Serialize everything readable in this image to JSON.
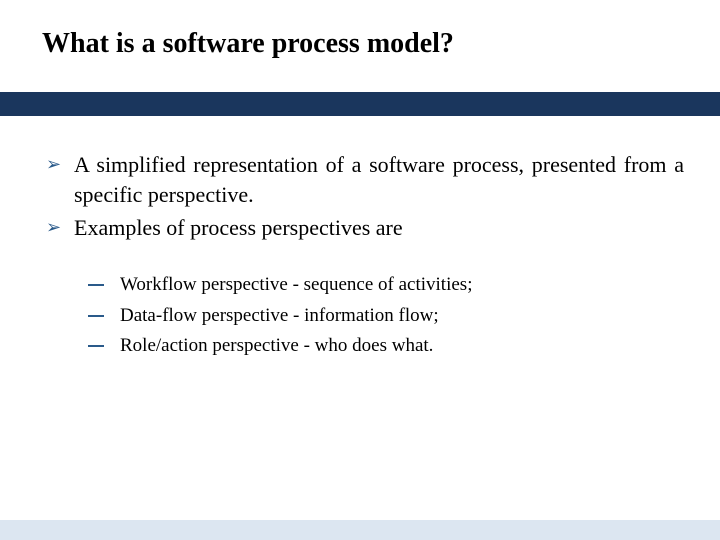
{
  "title": "What is a software process model?",
  "bullets": {
    "0": "A simplified representation of a software process, presented from a specific perspective.",
    "1": "Examples of process perspectives are"
  },
  "subbullets": {
    "0": "Workflow perspective - sequence of activities;",
    "1": "Data-flow perspective - information flow;",
    "2": "Role/action perspective - who does what."
  },
  "colors": {
    "accent_bar": "#1a365d",
    "bullet_marker": "#2a5a8a",
    "footer_bar": "#dce6f1"
  }
}
